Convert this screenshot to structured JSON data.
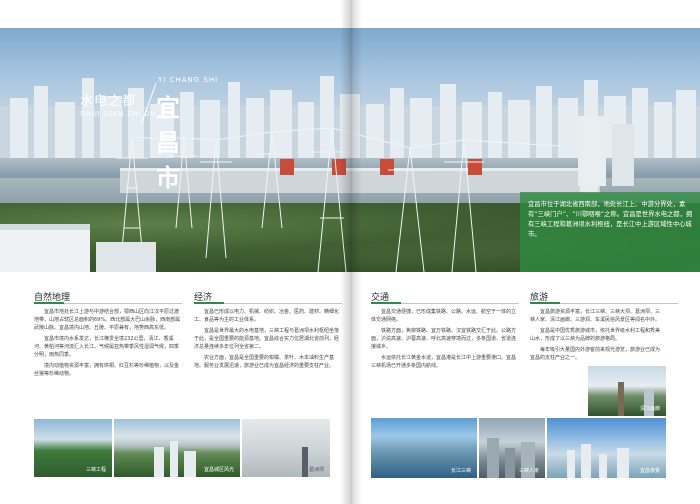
{
  "hero": {
    "title_small": "水电之都",
    "title_small_pinyin": "SHUI DIAN ZHI DU",
    "title_big": "宜昌市",
    "title_big_pinyin": "YI CHANG SHI",
    "overlay_text": "宜昌市位于湖北省西南部，地处长江上、中游分界处，素有“三峡门户”、“川鄂咽喉”之称。宜昌是世界水电之都，拥有三峡工程和葛洲坝水利枢纽，是长江中上游区域性中心城市。"
  },
  "sections": [
    {
      "heading": "自然地理",
      "paragraphs": [
        "宜昌市地处长江上游与中游结合部，鄂西山区向江汉平原过渡地带，山地占辖区总面积的69%。西北部属大巴山余脉，西南部属武陵山脉。宜昌境内山地、丘陵、平原兼有，地势西高东低。",
        "宜昌市境内水系发达，长江横贯全境232公里，清江、香溪河、黄柏河等河流汇入长江。气候属亚热带季风性湿润气候，四季分明，雨热同季。",
        "境内动植物资源丰富，拥有珙桐、红豆杉等珍稀植物，以及金丝猴等珍稀动物。"
      ]
    },
    {
      "heading": "经济",
      "paragraphs": [
        "宜昌已形成以电力、机械、纺织、冶金、医药、建材、精细化工、食品等为主的工业体系。",
        "宜昌是世界最大的水电基地，三峡工程与葛洲坝水利枢纽坐落于此，是全国重要的能源基地。宜昌综合实力位居湖北省前列，经济总量连续多年位列全省第二。",
        "农业方面，宜昌是全国重要的柑橘、茶叶、木本油料生产基地。服务业发展迅速，旅游业已成为宜昌经济的重要支柱产业。"
      ]
    },
    {
      "heading": "交通",
      "paragraphs": [
        "宜昌交通便捷，已形成集铁路、公路、水运、航空于一体的立体交通网络。",
        "铁路方面，焦柳铁路、宜万铁路、汉宜铁路交汇于此。公路方面，沪渝高速、沪蓉高速、呼北高速穿境而过，多条国道、省道连接城乡。",
        "水运依托长江黄金水道，宜昌港是长江中上游重要港口。宜昌三峡机场已开通多条国内航线。"
      ]
    },
    {
      "heading": "旅游",
      "paragraphs": [
        "宜昌旅游资源丰富，长江三峡、三峡大坝、葛洲坝、三峡人家、清江画廊、三游洞、车溪民俗风景区等闻名中外。",
        "宜昌是中国优秀旅游城市，依托世界级水利工程和秀美山水，形成了以三峡为品牌的旅游格局。",
        "每年吸引大量国内外游客前来观光游览，旅游业已成为宜昌的支柱产业之一。"
      ]
    }
  ],
  "photos": [
    {
      "caption": "三峡工程"
    },
    {
      "caption": "宜昌城区风光"
    },
    {
      "caption": "葛洲坝"
    },
    {
      "caption": "长江三峡"
    },
    {
      "caption": "三峡人家"
    },
    {
      "caption": "宜昌夜景"
    },
    {
      "caption": "清江画廊"
    }
  ]
}
